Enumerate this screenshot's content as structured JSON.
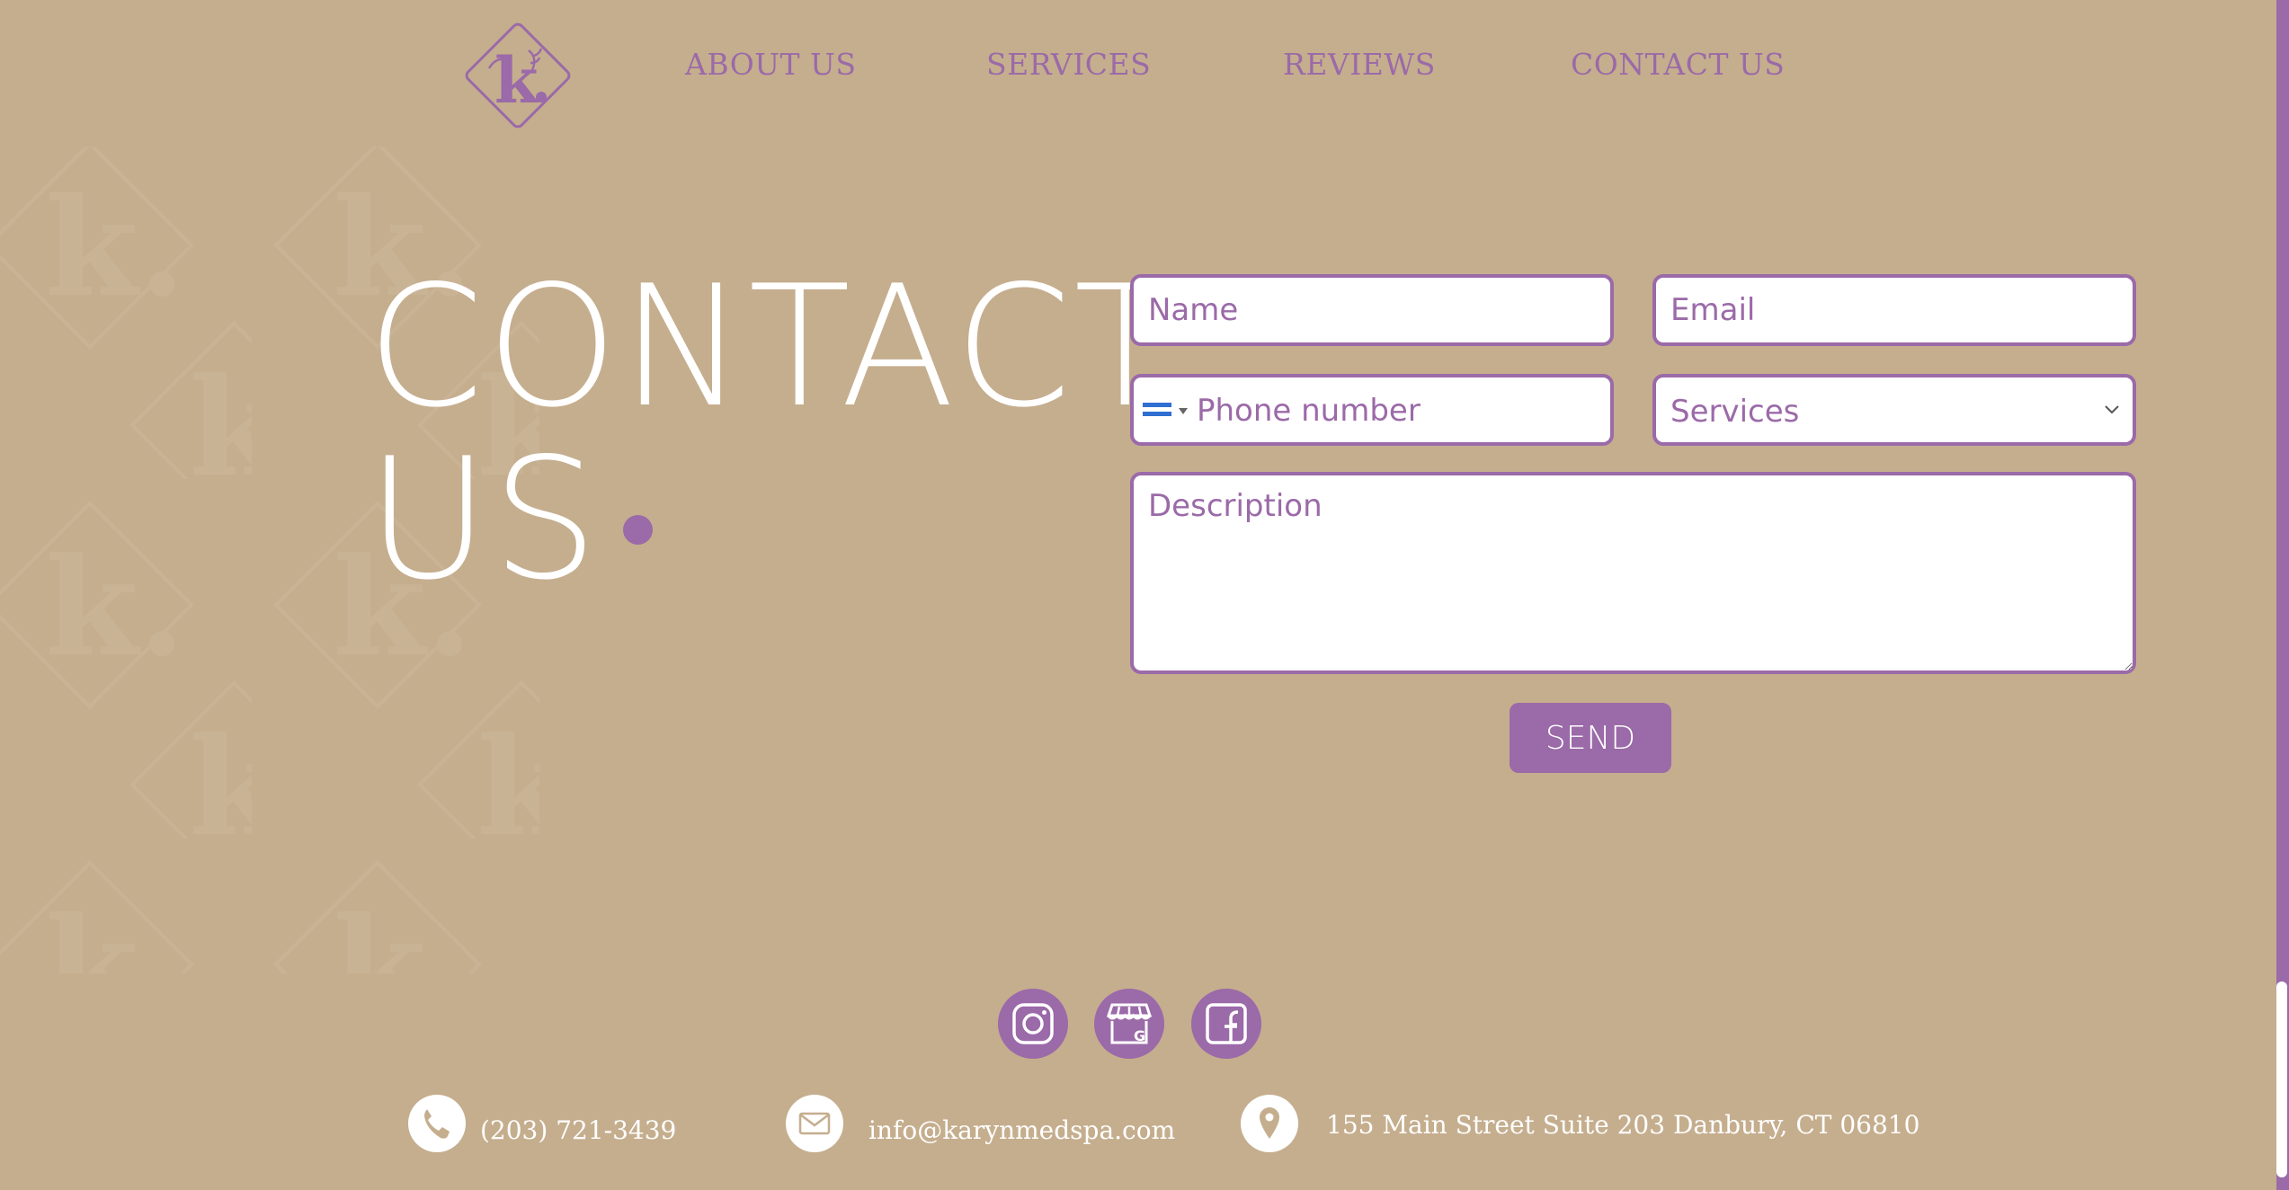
{
  "colors": {
    "background": "#c5ae8e",
    "accent": "#9b6aa8",
    "text_light": "#ffffff"
  },
  "nav": {
    "logo_icon": "k-diamond-logo",
    "items": [
      {
        "label": "ABOUT US"
      },
      {
        "label": "SERVICES"
      },
      {
        "label": "REVIEWS"
      },
      {
        "label": "CONTACT US"
      }
    ]
  },
  "hero": {
    "title_line1": "CONTACT",
    "title_line2": "US"
  },
  "form": {
    "name_placeholder": "Name",
    "email_placeholder": "Email",
    "phone_placeholder": "Phone number",
    "phone_flag_icon": "flag-icon",
    "services_selected": "Services",
    "description_placeholder": "Description",
    "send_label": "SEND"
  },
  "social": [
    {
      "icon": "instagram-icon"
    },
    {
      "icon": "google-business-icon"
    },
    {
      "icon": "facebook-icon"
    }
  ],
  "contact": {
    "phone": "(203) 721-3439",
    "email": "info@karynmedspa.com",
    "address": "155 Main Street Suite 203 Danbury, CT 06810"
  }
}
